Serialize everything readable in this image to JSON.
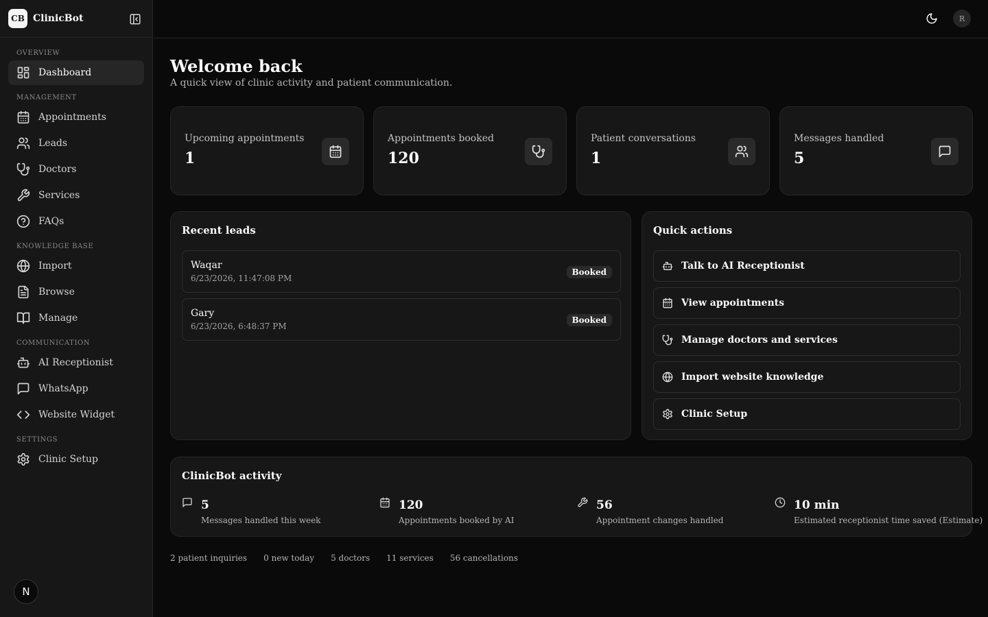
{
  "app": {
    "logo_initials": "CB",
    "brand": "ClinicBot"
  },
  "sidebar": {
    "groups": [
      {
        "label": "OVERVIEW",
        "items": [
          {
            "label": "Dashboard",
            "icon": "dashboard-icon",
            "active": true
          }
        ]
      },
      {
        "label": "MANAGEMENT",
        "items": [
          {
            "label": "Appointments",
            "icon": "calendar-icon"
          },
          {
            "label": "Leads",
            "icon": "users-icon"
          },
          {
            "label": "Doctors",
            "icon": "stethoscope-icon"
          },
          {
            "label": "Services",
            "icon": "wrench-icon"
          },
          {
            "label": "FAQs",
            "icon": "help-circle-icon"
          }
        ]
      },
      {
        "label": "KNOWLEDGE BASE",
        "items": [
          {
            "label": "Import",
            "icon": "globe-icon"
          },
          {
            "label": "Browse",
            "icon": "file-text-icon"
          },
          {
            "label": "Manage",
            "icon": "book-open-icon"
          }
        ]
      },
      {
        "label": "COMMUNICATION",
        "items": [
          {
            "label": "AI Receptionist",
            "icon": "bot-icon"
          },
          {
            "label": "WhatsApp",
            "icon": "message-square-icon"
          },
          {
            "label": "Website Widget",
            "icon": "code-icon"
          }
        ]
      },
      {
        "label": "SETTINGS",
        "items": [
          {
            "label": "Clinic Setup",
            "icon": "settings-icon"
          }
        ]
      }
    ],
    "footer_badge": "N"
  },
  "topbar": {
    "avatar_initial": "R"
  },
  "main": {
    "title": "Welcome back",
    "subtitle": "A quick view of clinic activity and patient communication.",
    "stats": [
      {
        "label": "Upcoming appointments",
        "value": "1",
        "icon": "calendar-icon"
      },
      {
        "label": "Appointments booked",
        "value": "120",
        "icon": "stethoscope-icon"
      },
      {
        "label": "Patient conversations",
        "value": "1",
        "icon": "users-icon"
      },
      {
        "label": "Messages handled",
        "value": "5",
        "icon": "message-square-icon"
      }
    ],
    "recent_leads": {
      "title": "Recent leads",
      "items": [
        {
          "name": "Waqar",
          "date": "6/23/2026, 11:47:08 PM",
          "status": "Booked"
        },
        {
          "name": "Gary",
          "date": "6/23/2026, 6:48:37 PM",
          "status": "Booked"
        }
      ]
    },
    "quick_actions": {
      "title": "Quick actions",
      "items": [
        {
          "label": "Talk to AI Receptionist",
          "icon": "bot-icon"
        },
        {
          "label": "View appointments",
          "icon": "calendar-icon"
        },
        {
          "label": "Manage doctors and services",
          "icon": "stethoscope-icon"
        },
        {
          "label": "Import website knowledge",
          "icon": "globe-icon"
        },
        {
          "label": "Clinic Setup",
          "icon": "settings-icon"
        }
      ]
    },
    "activity": {
      "title": "ClinicBot activity",
      "items": [
        {
          "value": "5",
          "label": "Messages handled this week",
          "icon": "message-square-icon"
        },
        {
          "value": "120",
          "label": "Appointments booked by AI",
          "icon": "calendar-icon"
        },
        {
          "value": "56",
          "label": "Appointment changes handled",
          "icon": "wrench-icon"
        },
        {
          "value": "10 min",
          "label": "Estimated receptionist time saved (Estimate)",
          "icon": "clock-icon"
        }
      ]
    },
    "footer_stats": [
      "2 patient inquiries",
      "0 new today",
      "5 doctors",
      "11 services",
      "56 cancellations"
    ]
  }
}
